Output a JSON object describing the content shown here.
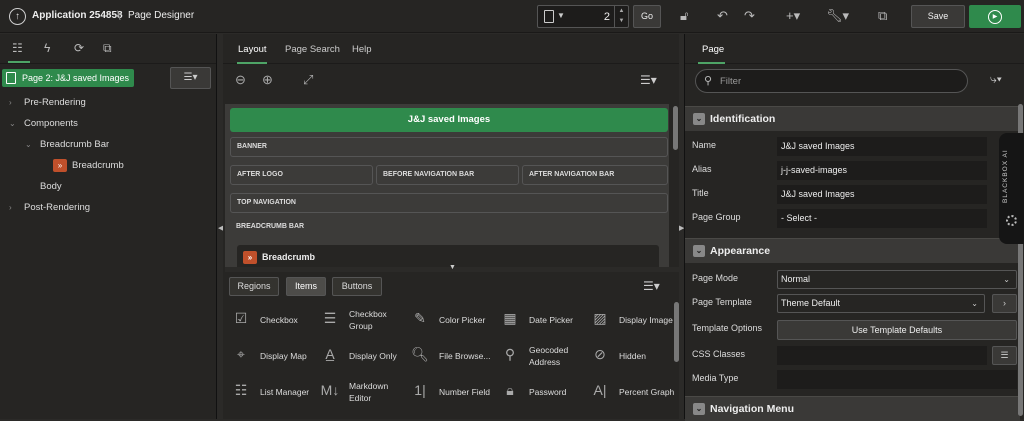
{
  "topbar": {
    "app_title": "Application 254858",
    "separator": "\\",
    "page_designer": "Page Designer",
    "page_number": "2",
    "go_label": "Go",
    "save_label": "Save"
  },
  "left": {
    "page_badge": "Page 2: J&J saved Images",
    "tree": {
      "pre_rendering": "Pre-Rendering",
      "components": "Components",
      "breadcrumb_bar": "Breadcrumb Bar",
      "breadcrumb": "Breadcrumb",
      "body": "Body",
      "post_rendering": "Post-Rendering"
    }
  },
  "middle": {
    "tabs": [
      "Layout",
      "Page Search",
      "Help"
    ],
    "canvas": {
      "banner_title": "J&J saved Images",
      "banner": "BANNER",
      "after_logo": "AFTER LOGO",
      "before_nav": "BEFORE NAVIGATION BAR",
      "after_nav": "AFTER NAVIGATION BAR",
      "top_nav": "TOP NAVIGATION",
      "breadcrumb_bar": "BREADCRUMB BAR",
      "breadcrumb": "Breadcrumb"
    },
    "gallery_tabs": [
      "Regions",
      "Items",
      "Buttons"
    ],
    "gallery_items": [
      {
        "label": "Checkbox",
        "icon": "checkbox-icon"
      },
      {
        "label": "Checkbox Group",
        "icon": "checkbox-group-icon"
      },
      {
        "label": "Color Picker",
        "icon": "color-picker-icon"
      },
      {
        "label": "Date Picker",
        "icon": "date-picker-icon"
      },
      {
        "label": "Display Image",
        "icon": "display-image-icon"
      },
      {
        "label": "Display Map",
        "icon": "display-map-icon"
      },
      {
        "label": "Display Only",
        "icon": "display-only-icon"
      },
      {
        "label": "File Browse...",
        "icon": "file-browse-icon"
      },
      {
        "label": "Geocoded Address",
        "icon": "geocoded-address-icon"
      },
      {
        "label": "Hidden",
        "icon": "hidden-icon"
      },
      {
        "label": "List Manager",
        "icon": "list-manager-icon"
      },
      {
        "label": "Markdown Editor",
        "icon": "markdown-editor-icon"
      },
      {
        "label": "Number Field",
        "icon": "number-field-icon"
      },
      {
        "label": "Password",
        "icon": "password-icon"
      },
      {
        "label": "Percent Graph",
        "icon": "percent-graph-icon"
      }
    ]
  },
  "right": {
    "tab": "Page",
    "filter_placeholder": "Filter",
    "identification": {
      "title": "Identification",
      "name_label": "Name",
      "name_value": "J&J saved Images",
      "alias_label": "Alias",
      "alias_value": "j-j-saved-images",
      "title_label": "Title",
      "title_value": "J&J saved Images",
      "group_label": "Page Group",
      "group_value": "- Select -"
    },
    "appearance": {
      "title": "Appearance",
      "mode_label": "Page Mode",
      "mode_value": "Normal",
      "template_label": "Page Template",
      "template_value": "Theme Default",
      "options_label": "Template Options",
      "options_button": "Use Template Defaults",
      "css_label": "CSS Classes",
      "css_value": "",
      "media_label": "Media Type",
      "media_value": ""
    },
    "navigation_menu": {
      "title": "Navigation Menu"
    },
    "ai_widget": "BLACKBOX AI"
  }
}
